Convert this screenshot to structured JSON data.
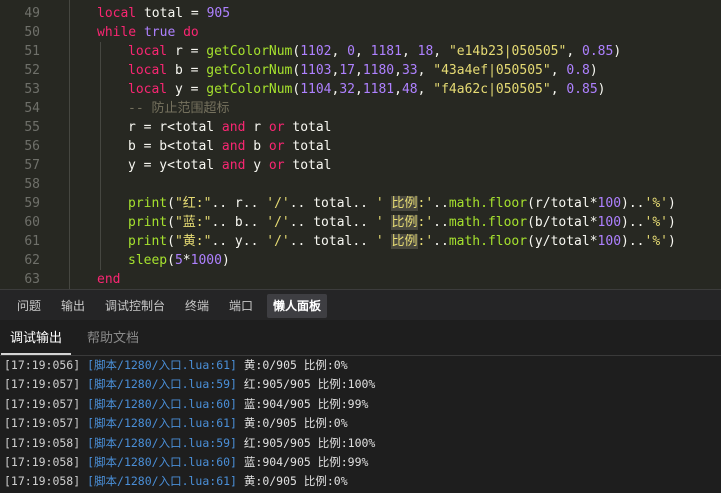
{
  "editor": {
    "lines": [
      {
        "n": "49",
        "indent": 1,
        "tokens": [
          [
            "kw",
            "local"
          ],
          [
            "",
            " total = "
          ],
          [
            "num",
            "905"
          ]
        ]
      },
      {
        "n": "50",
        "indent": 1,
        "tokens": [
          [
            "kw",
            "while"
          ],
          [
            "",
            " "
          ],
          [
            "num",
            "true"
          ],
          [
            "",
            " "
          ],
          [
            "kw",
            "do"
          ]
        ]
      },
      {
        "n": "51",
        "indent": 2,
        "tokens": [
          [
            "kw",
            "local"
          ],
          [
            "",
            " r = "
          ],
          [
            "fn",
            "getColorNum"
          ],
          [
            "",
            "("
          ],
          [
            "num",
            "1102"
          ],
          [
            "",
            ", "
          ],
          [
            "num",
            "0"
          ],
          [
            "",
            ", "
          ],
          [
            "num",
            "1181"
          ],
          [
            "",
            ", "
          ],
          [
            "num",
            "18"
          ],
          [
            "",
            ", "
          ],
          [
            "str",
            "\"e14b23|050505\""
          ],
          [
            "",
            ", "
          ],
          [
            "num",
            "0.85"
          ],
          [
            "",
            ")"
          ]
        ]
      },
      {
        "n": "52",
        "indent": 2,
        "tokens": [
          [
            "kw",
            "local"
          ],
          [
            "",
            " b = "
          ],
          [
            "fn",
            "getColorNum"
          ],
          [
            "",
            "("
          ],
          [
            "num",
            "1103"
          ],
          [
            "",
            ","
          ],
          [
            "num",
            "17"
          ],
          [
            "",
            ","
          ],
          [
            "num",
            "1180"
          ],
          [
            "",
            ","
          ],
          [
            "num",
            "33"
          ],
          [
            "",
            ", "
          ],
          [
            "str",
            "\"43a4ef|050505\""
          ],
          [
            "",
            ", "
          ],
          [
            "num",
            "0.8"
          ],
          [
            "",
            ")"
          ]
        ]
      },
      {
        "n": "53",
        "indent": 2,
        "tokens": [
          [
            "kw",
            "local"
          ],
          [
            "",
            " y = "
          ],
          [
            "fn",
            "getColorNum"
          ],
          [
            "",
            "("
          ],
          [
            "num",
            "1104"
          ],
          [
            "",
            ","
          ],
          [
            "num",
            "32"
          ],
          [
            "",
            ","
          ],
          [
            "num",
            "1181"
          ],
          [
            "",
            ","
          ],
          [
            "num",
            "48"
          ],
          [
            "",
            ", "
          ],
          [
            "str",
            "\"f4a62c|050505\""
          ],
          [
            "",
            ", "
          ],
          [
            "num",
            "0.85"
          ],
          [
            "",
            ")"
          ]
        ]
      },
      {
        "n": "54",
        "indent": 2,
        "tokens": [
          [
            "cmt",
            "-- 防止范围超标"
          ]
        ]
      },
      {
        "n": "55",
        "indent": 2,
        "tokens": [
          [
            "",
            "r = r<total "
          ],
          [
            "kw",
            "and"
          ],
          [
            "",
            " r "
          ],
          [
            "kw",
            "or"
          ],
          [
            "",
            " total"
          ]
        ]
      },
      {
        "n": "56",
        "indent": 2,
        "tokens": [
          [
            "",
            "b = b<total "
          ],
          [
            "kw",
            "and"
          ],
          [
            "",
            " b "
          ],
          [
            "kw",
            "or"
          ],
          [
            "",
            " total"
          ]
        ]
      },
      {
        "n": "57",
        "indent": 2,
        "tokens": [
          [
            "",
            "y = y<total "
          ],
          [
            "kw",
            "and"
          ],
          [
            "",
            " y "
          ],
          [
            "kw",
            "or"
          ],
          [
            "",
            " total"
          ]
        ]
      },
      {
        "n": "58",
        "indent": 2,
        "tokens": []
      },
      {
        "n": "59",
        "indent": 2,
        "tokens": [
          [
            "fn",
            "print"
          ],
          [
            "",
            "("
          ],
          [
            "str",
            "\"红:\""
          ],
          [
            "",
            ".. r.. "
          ],
          [
            "str",
            "'/'"
          ],
          [
            "",
            ".. total.. "
          ],
          [
            "str",
            "' "
          ],
          [
            "strhl",
            "比例"
          ],
          [
            "str",
            ":'"
          ],
          [
            "",
            ".."
          ],
          [
            "fn",
            "math.floor"
          ],
          [
            "",
            "(r/total*"
          ],
          [
            "num",
            "100"
          ],
          [
            "",
            ").."
          ],
          [
            "str",
            "'%'"
          ],
          [
            "",
            ")"
          ]
        ]
      },
      {
        "n": "60",
        "indent": 2,
        "tokens": [
          [
            "fn",
            "print"
          ],
          [
            "",
            "("
          ],
          [
            "str",
            "\"蓝:\""
          ],
          [
            "",
            ".. b.. "
          ],
          [
            "str",
            "'/'"
          ],
          [
            "",
            ".. total.. "
          ],
          [
            "str",
            "' "
          ],
          [
            "strhl",
            "比例"
          ],
          [
            "str",
            ":'"
          ],
          [
            "",
            ".."
          ],
          [
            "fn",
            "math.floor"
          ],
          [
            "",
            "(b/total*"
          ],
          [
            "num",
            "100"
          ],
          [
            "",
            ").."
          ],
          [
            "str",
            "'%'"
          ],
          [
            "",
            ")"
          ]
        ]
      },
      {
        "n": "61",
        "indent": 2,
        "tokens": [
          [
            "fn",
            "print"
          ],
          [
            "",
            "("
          ],
          [
            "str",
            "\"黄:\""
          ],
          [
            "",
            ".. y.. "
          ],
          [
            "str",
            "'/'"
          ],
          [
            "",
            ".. total.. "
          ],
          [
            "str",
            "' "
          ],
          [
            "strhl",
            "比例"
          ],
          [
            "str",
            ":'"
          ],
          [
            "",
            ".."
          ],
          [
            "fn",
            "math.floor"
          ],
          [
            "",
            "(y/total*"
          ],
          [
            "num",
            "100"
          ],
          [
            "",
            ").."
          ],
          [
            "str",
            "'%'"
          ],
          [
            "",
            ")"
          ]
        ]
      },
      {
        "n": "62",
        "indent": 2,
        "tokens": [
          [
            "fn",
            "sleep"
          ],
          [
            "",
            "("
          ],
          [
            "num",
            "5"
          ],
          [
            "",
            "*"
          ],
          [
            "num",
            "1000"
          ],
          [
            "",
            ")"
          ]
        ]
      },
      {
        "n": "63",
        "indent": 1,
        "tokens": [
          [
            "kw",
            "end"
          ]
        ]
      }
    ]
  },
  "panel_tabs": [
    {
      "label": "问题",
      "active": false
    },
    {
      "label": "输出",
      "active": false
    },
    {
      "label": "调试控制台",
      "active": false
    },
    {
      "label": "终端",
      "active": false
    },
    {
      "label": "端口",
      "active": false
    },
    {
      "label": "懒人面板",
      "active": true
    }
  ],
  "sub_tabs": [
    {
      "label": "调试输出",
      "active": true
    },
    {
      "label": "帮助文档",
      "active": false
    }
  ],
  "output": [
    {
      "ts": "[17:19:056]",
      "src": "[脚本/1280/入口.lua:61]",
      "msg": "黄:0/905 比例:0%"
    },
    {
      "ts": "[17:19:057]",
      "src": "[脚本/1280/入口.lua:59]",
      "msg": "红:905/905 比例:100%"
    },
    {
      "ts": "[17:19:057]",
      "src": "[脚本/1280/入口.lua:60]",
      "msg": "蓝:904/905 比例:99%"
    },
    {
      "ts": "[17:19:057]",
      "src": "[脚本/1280/入口.lua:61]",
      "msg": "黄:0/905 比例:0%"
    },
    {
      "ts": "[17:19:058]",
      "src": "[脚本/1280/入口.lua:59]",
      "msg": "红:905/905 比例:100%"
    },
    {
      "ts": "[17:19:058]",
      "src": "[脚本/1280/入口.lua:60]",
      "msg": "蓝:904/905 比例:99%"
    },
    {
      "ts": "[17:19:058]",
      "src": "[脚本/1280/入口.lua:61]",
      "msg": "黄:0/905 比例:0%"
    }
  ]
}
